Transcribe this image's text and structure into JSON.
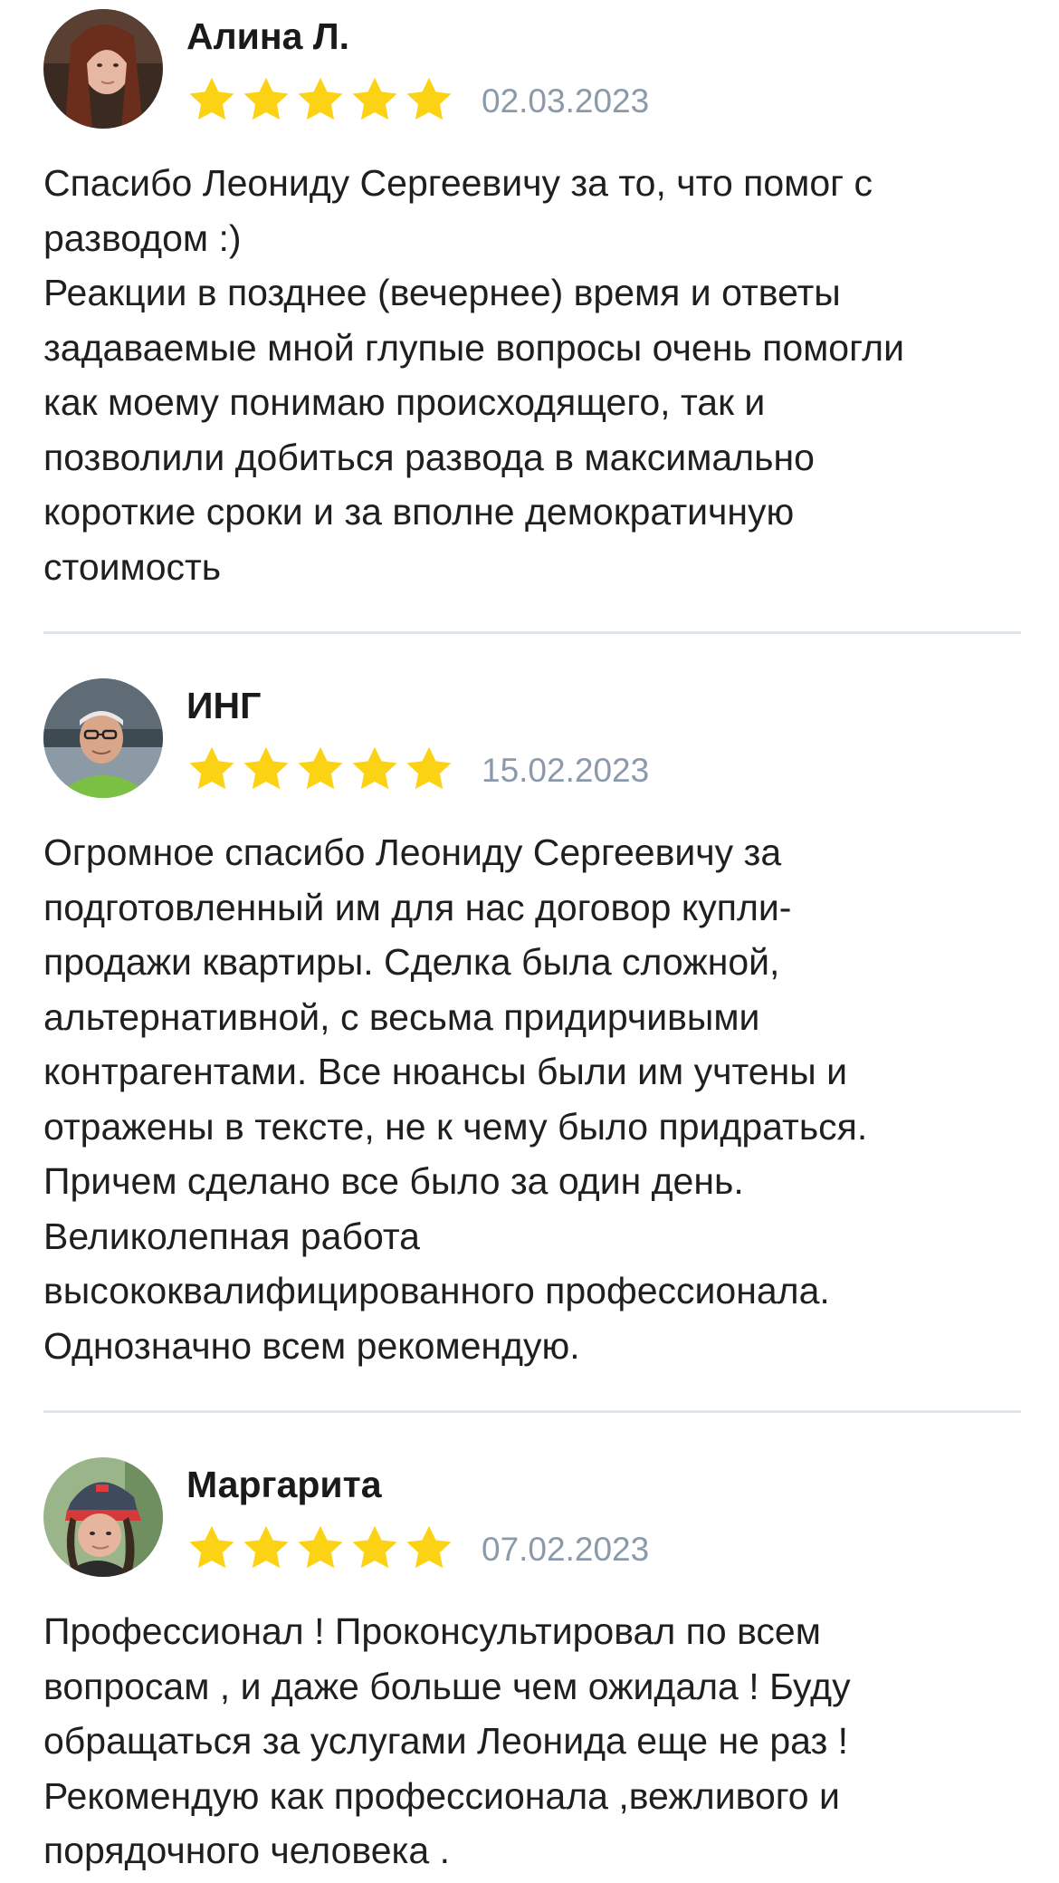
{
  "reviews": [
    {
      "author": "Алина Л.",
      "rating": 5,
      "date": "02.03.2023",
      "text": "Спасибо Леониду Сергеевичу за то, что помог с\nразводом :)\nРеакции в позднее (вечернее) время и ответы\nзадаваемые мной глупые вопросы очень помогли\nкак моему понимаю происходящего, так и\nпозволили добиться развода в максимально\nкороткие сроки и за вполне демократичную\nстоимость",
      "avatar_icon": "user-photo-avatar"
    },
    {
      "author": "ИНГ",
      "rating": 5,
      "date": "15.02.2023",
      "text": "Огромное спасибо Леониду Сергеевичу за\nподготовленный им для нас договор купли-\nпродажи квартиры. Сделка была сложной,\nальтернативной, с весьма придирчивыми\nконтрагентами. Все нюансы были им учтены и\nотражены в тексте, не к чему было придраться.\nПричем сделано все было за один день.\nВеликолепная работа\nвысококвалифицированного профессионала.\nОднозначно всем рекомендую.",
      "avatar_icon": "user-photo-avatar"
    },
    {
      "author": "Маргарита",
      "rating": 5,
      "date": "07.02.2023",
      "text": "Профессионал ! Проконсультировал по всем\nвопросам , и даже больше чем ожидала ! Буду\nобращаться за услугами Леонида еще не раз !\nРекомендую как профессионала ,вежливого и\nпорядочного человека .",
      "avatar_icon": "user-photo-avatar"
    }
  ],
  "colors": {
    "star": "#fcd215",
    "date": "#8a9aab",
    "divider": "#dce6ee",
    "text": "#1f1f1f"
  }
}
